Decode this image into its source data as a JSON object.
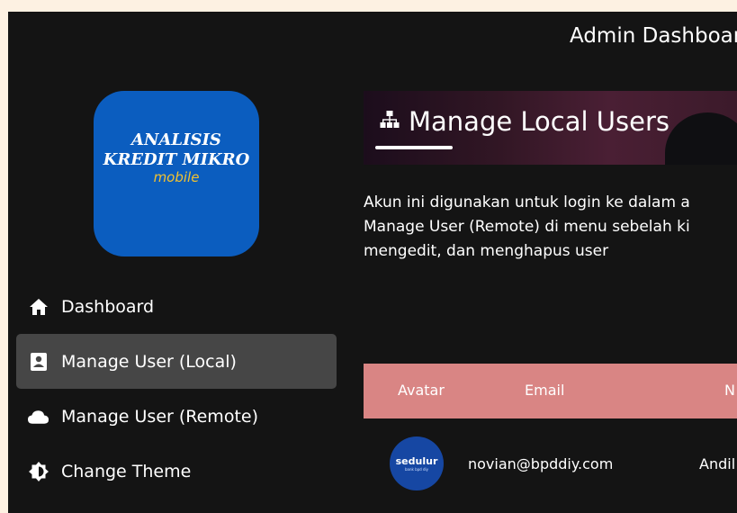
{
  "header": {
    "title": "Admin Dashboard"
  },
  "logo": {
    "line1": "ANALISIS",
    "line2": "KREDIT MIKRO",
    "line3": "mobile"
  },
  "sidebar": {
    "items": [
      {
        "label": "Dashboard",
        "icon": "home-icon"
      },
      {
        "label": "Manage User (Local)",
        "icon": "user-badge-icon",
        "active": true
      },
      {
        "label": "Manage User (Remote)",
        "icon": "cloud-icon"
      },
      {
        "label": "Change Theme",
        "icon": "brightness-icon"
      }
    ]
  },
  "main": {
    "banner_title": "Manage Local Users",
    "description": [
      "Akun ini digunakan untuk login ke dalam a",
      "Manage User (Remote) di menu sebelah ki",
      "mengedit, dan menghapus user"
    ],
    "table": {
      "headers": [
        "Avatar",
        "Email",
        "N"
      ],
      "rows": [
        {
          "avatar_text": "sedulur",
          "avatar_sub": "bank bpd diy",
          "email": "novian@bpddiy.com",
          "name": "Andil"
        }
      ]
    }
  },
  "colors": {
    "background": "#141414",
    "active_nav": "#464646",
    "table_header": "#d98584",
    "logo_bg": "#0b5dbf",
    "logo_accent": "#f2c230"
  }
}
